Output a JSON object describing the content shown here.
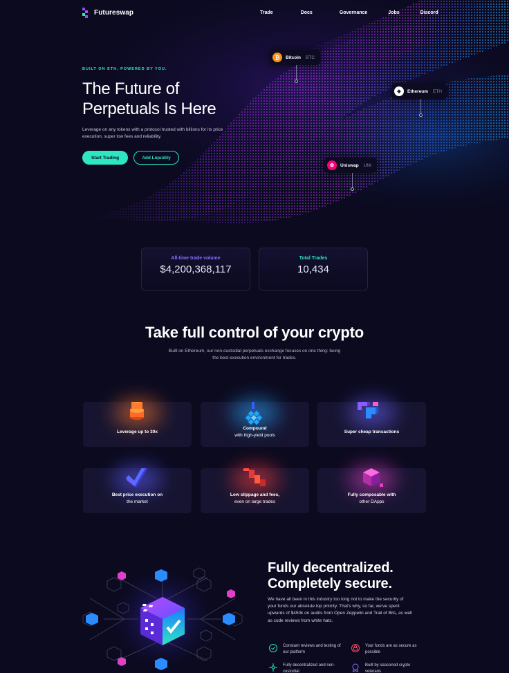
{
  "brand": {
    "name": "Futureswap"
  },
  "nav": [
    {
      "label": "Trade"
    },
    {
      "label": "Docs"
    },
    {
      "label": "Governance"
    },
    {
      "label": "Jobs"
    },
    {
      "label": "Discord"
    }
  ],
  "hero": {
    "eyebrow": "BUILT ON ETH. POWERED BY YOU.",
    "title_line1": "The Future of",
    "title_line2": "Perpetuals Is Here",
    "description": "Leverage on any tokens with a protocol trusted with billions for its price execution, super low fees and reliability.",
    "primary_button": "Start Trading",
    "secondary_button": "Add Liquidity"
  },
  "tokens": [
    {
      "name": "Bitcoin",
      "ticker": "BTC",
      "icon": "bitcoin-icon",
      "color": "#f7931a",
      "glyph": "₿"
    },
    {
      "name": "Ethereum",
      "ticker": "ETH",
      "icon": "ethereum-icon",
      "color": "#ffffff",
      "glyph": "◆"
    },
    {
      "name": "Uniswap",
      "ticker": "UNI",
      "icon": "uniswap-icon",
      "color": "#ff007a",
      "glyph": "✿"
    }
  ],
  "stats": [
    {
      "label": "All-time trade volume",
      "value": "$4,200,368,117",
      "color": "#8b6dff"
    },
    {
      "label": "Total Trades",
      "value": "10,434",
      "color": "#2ee6c1"
    }
  ],
  "features_section": {
    "title": "Take full control of your crypto",
    "description": "Built on Ethereum, our non-custodial perpetuals exchange focuses on one thing: being the best execution environment for trades."
  },
  "feature_cards": [
    {
      "title": "Leverage up to 30x",
      "subtitle": "",
      "icon": "coin-stack-icon",
      "glow": "#ff7a2d"
    },
    {
      "title": "Compound",
      "subtitle": "with high-yield pools",
      "icon": "cube-cluster-icon",
      "glow": "#28a9ff"
    },
    {
      "title": "Super cheap transactions",
      "subtitle": "",
      "icon": "blocks-icon",
      "glow": "#6b63ff"
    },
    {
      "title": "Best price execution on",
      "subtitle": "the market",
      "icon": "checkmark-3d-icon",
      "glow": "#5a5bff"
    },
    {
      "title": "Low slippage and fees,",
      "subtitle": "even on large trades",
      "icon": "steps-icon",
      "glow": "#ff3d3d"
    },
    {
      "title": "Fully composable with",
      "subtitle": "other DApps",
      "icon": "composable-cube-icon",
      "glow": "#e040c8"
    }
  ],
  "security": {
    "title_line1": "Fully decentralized.",
    "title_line2": "Completely secure.",
    "description": "We have all been in this industry too long not to make the security of your funds our absolute top priority.  That's why, so far, we've spent upwards of $450k on audits from Open Zeppelin and Trail of Bits, as well as code reviews from white hats.",
    "points": [
      {
        "text": "Constant reviews and testing of our platform",
        "icon": "review-icon"
      },
      {
        "text": "Your funds are as secure as possible",
        "icon": "lock-icon"
      },
      {
        "text": "Fully decentralized and non-custodial",
        "icon": "network-icon"
      },
      {
        "text": "Built by seasoned crypto veterans",
        "icon": "badge-icon"
      }
    ]
  }
}
